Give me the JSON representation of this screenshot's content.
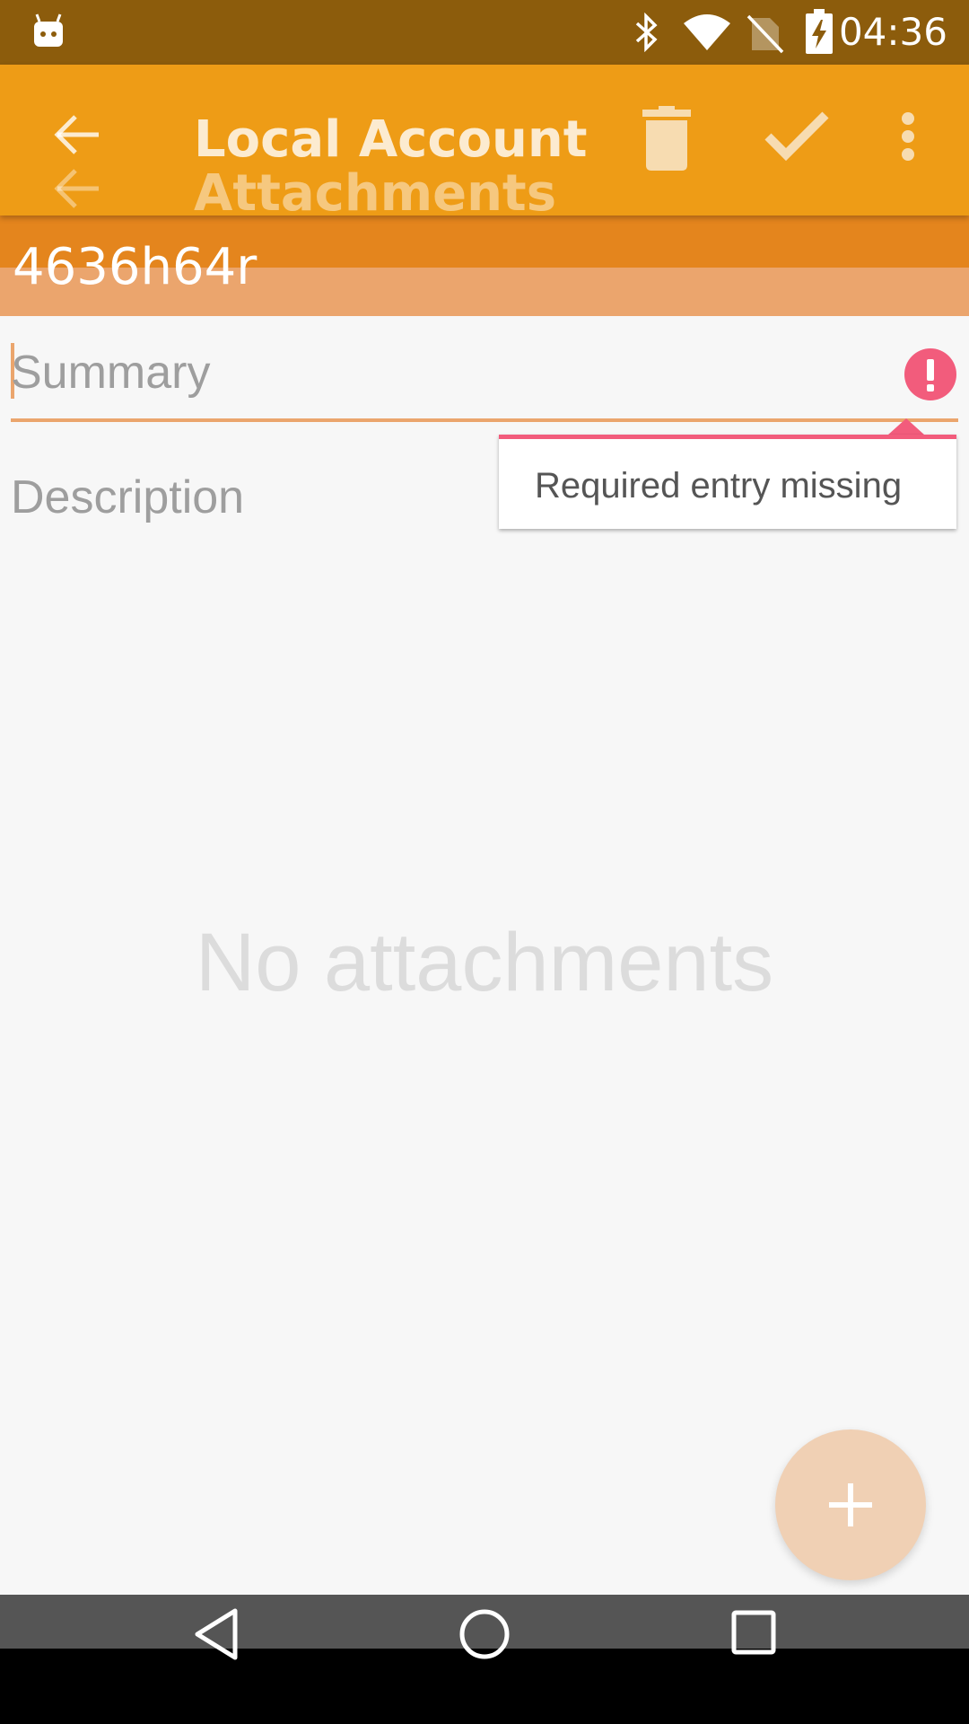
{
  "status_bar": {
    "time": "04:36",
    "icons": [
      "android-notification-icon",
      "bluetooth-icon",
      "wifi-icon",
      "no-sim-icon",
      "battery-charging-icon"
    ]
  },
  "toolbar": {
    "title": "Local Account",
    "subtitle": "Attachments",
    "actions": [
      "back-arrow-icon",
      "delete-icon",
      "check-icon",
      "more-vert-icon"
    ]
  },
  "account": {
    "id": "4636h64r"
  },
  "form": {
    "summary_placeholder": "Summary",
    "description_placeholder": "Description",
    "error_message": "Required entry missing"
  },
  "attachments": {
    "empty_text": "No attachments"
  },
  "fab": {
    "icon": "add-icon"
  },
  "nav": {
    "icons": [
      "back-triangle-icon",
      "home-circle-icon",
      "recents-square-icon"
    ]
  },
  "colors": {
    "status_bar": "#8c5c0c",
    "toolbar": "#ee9c16",
    "accent": "#e4851d",
    "error": "#f25c7c",
    "fab": "#f0d0b4"
  }
}
